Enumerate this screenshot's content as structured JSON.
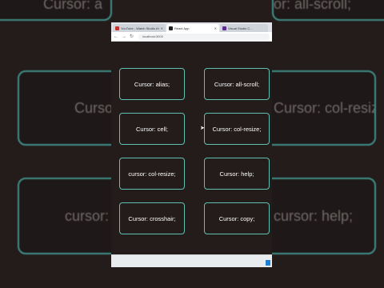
{
  "browser": {
    "tabs": [
      {
        "title": "YouTube - Watch Studio #Youtube",
        "favicon_color": "#c4302b",
        "active": false
      },
      {
        "title": "React App",
        "favicon_color": "#222222",
        "active": true
      },
      {
        "title": "Visual Studio C...",
        "favicon_color": "#5c2d91",
        "active": false
      }
    ],
    "address": "localhost:3000",
    "icons": {
      "back": "arrow-left-icon",
      "forward": "arrow-right-icon",
      "reload": "reload-icon"
    }
  },
  "cards": [
    {
      "label": "Cursor: alias;"
    },
    {
      "label": "Cursor: all-scroll;"
    },
    {
      "label": "Cursor: cell;"
    },
    {
      "label": "Cursor: col-resize;"
    },
    {
      "label": "cursor: col-resize;"
    },
    {
      "label": "Cursor: help;"
    },
    {
      "label": "Cursor: crosshair;"
    },
    {
      "label": "Cursor: copy;"
    }
  ],
  "background": {
    "top_left": "Cursor: a",
    "top_right": "Cursor: all-scroll;",
    "mid_left": "Cursor: c",
    "mid_right": "Cursor: col-resize;",
    "bot_left": "cursor: col-",
    "bot_right": "cursor: help;"
  },
  "colors": {
    "accent": "#5fc0b1",
    "page_bg": "#241b1b"
  }
}
